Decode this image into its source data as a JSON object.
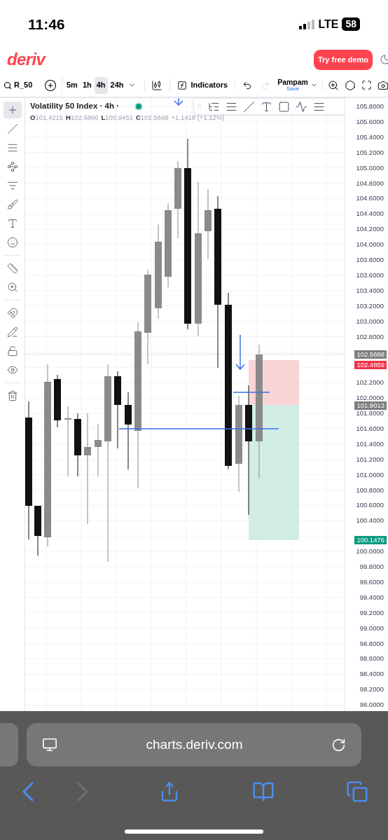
{
  "status_bar": {
    "time": "11:46",
    "network": "LTE",
    "battery": "58"
  },
  "header": {
    "logo": "deriv",
    "cta": "Try free demo"
  },
  "toolbar": {
    "symbol": "R_50",
    "timeframes": [
      {
        "label": "5m",
        "selected": false
      },
      {
        "label": "1h",
        "selected": false
      },
      {
        "label": "4h",
        "selected": true
      },
      {
        "label": "24h",
        "selected": false
      }
    ],
    "indicators": "Indicators",
    "template": {
      "name": "Pampam",
      "action": "Save"
    }
  },
  "chart": {
    "title": "Volatility 50 Index · 4h ·",
    "ohlc": [
      {
        "key": "O",
        "value": "101.4215"
      },
      {
        "key": "H",
        "value": "102.6866"
      },
      {
        "key": "L",
        "value": "100.9451"
      },
      {
        "key": "C",
        "value": "102.5668"
      }
    ],
    "change": "+1.1418 (+1.12%)",
    "tools": [
      {
        "selected": true
      },
      {
        "selected": false
      },
      {
        "selected": false
      },
      {
        "selected": false
      },
      {
        "selected": false
      },
      {
        "selected": false
      },
      {
        "selected": false
      },
      {
        "selected": false
      },
      {
        "selected": false
      },
      {
        "selected": false
      },
      {
        "selected": false
      },
      {
        "selected": false
      },
      {
        "selected": false
      },
      {
        "selected": false
      },
      {
        "selected": false
      }
    ]
  },
  "price_axis": {
    "ticks": [
      "105.8000",
      "105.6000",
      "105.4000",
      "105.2000",
      "105.0000",
      "104.8000",
      "104.6000",
      "104.4000",
      "104.2000",
      "104.0000",
      "103.8000",
      "103.6000",
      "103.4000",
      "103.2000",
      "103.0000",
      "102.8000",
      "102.2000",
      "102.0000",
      "101.8000",
      "101.6000",
      "101.4000",
      "101.2000",
      "101.0000",
      "100.8000",
      "100.6000",
      "100.4000",
      "100.0000",
      "99.8000",
      "99.6000",
      "99.4000",
      "99.2000",
      "99.0000",
      "98.8000",
      "98.6000",
      "98.4000",
      "98.2000",
      "98.0000"
    ],
    "badges": [
      {
        "value": "102.5668",
        "color": "#7d7d7d"
      },
      {
        "value": "102.4859",
        "color": "#f0334a"
      },
      {
        "value": "101.9013",
        "color": "#7d7d7d"
      },
      {
        "value": "100.1476",
        "color": "#0c9a7f"
      }
    ]
  },
  "browser": {
    "url": "charts.deriv.com",
    "forward_disabled": true
  }
}
